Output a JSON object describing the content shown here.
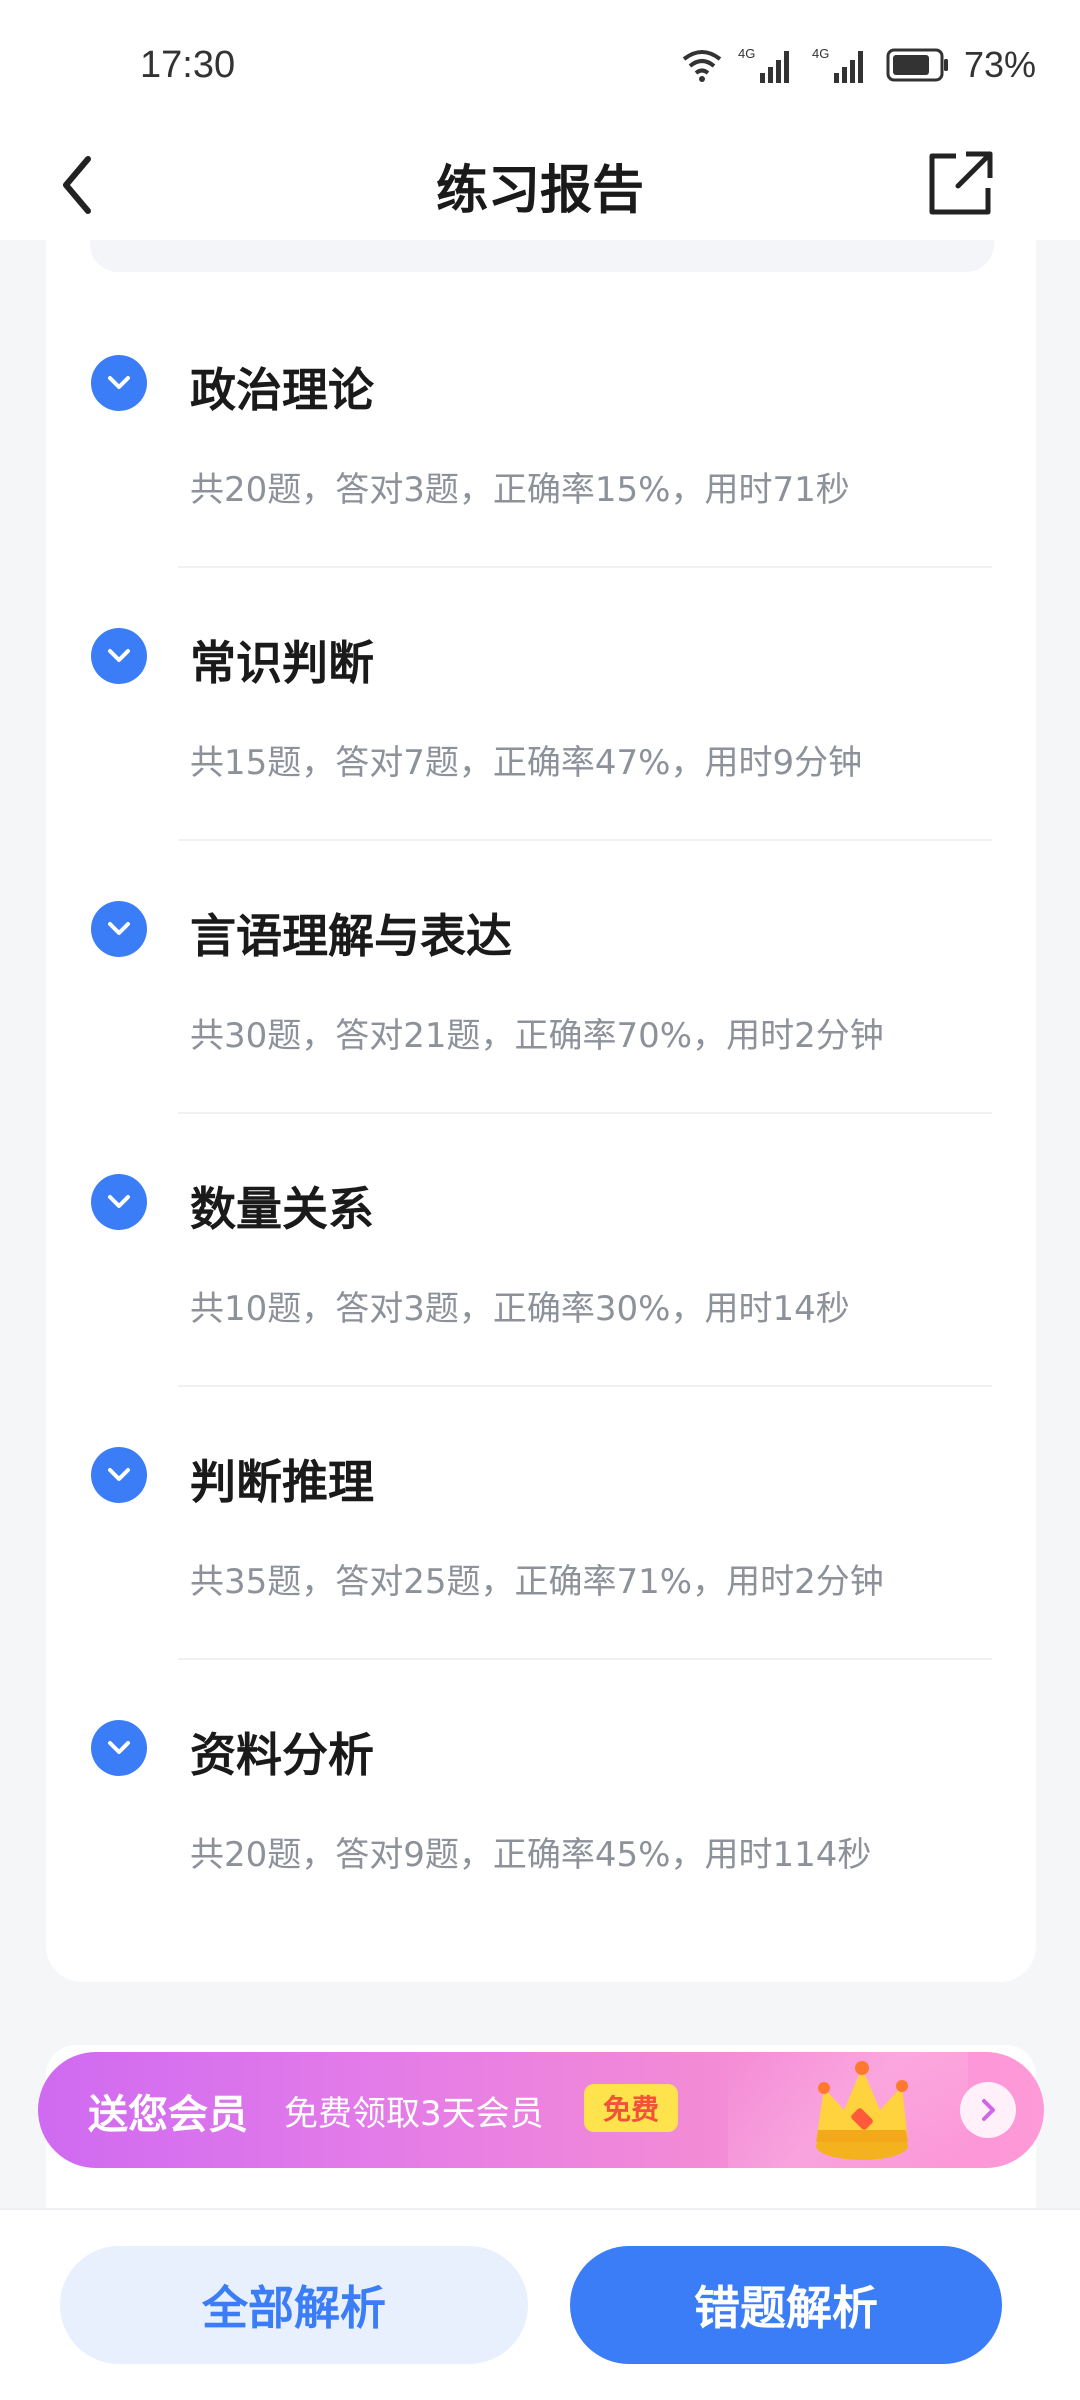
{
  "status_bar": {
    "time": "17:30",
    "network_1": "4G",
    "network_2": "4G",
    "battery": "73%"
  },
  "nav": {
    "title": "练习报告",
    "back_icon": "chevron-left-icon",
    "share_icon": "share-external-icon"
  },
  "sections": [
    {
      "title": "政治理论",
      "stats": "共20题，答对3题，正确率15%，用时71秒"
    },
    {
      "title": "常识判断",
      "stats": "共15题，答对7题，正确率47%，用时9分钟"
    },
    {
      "title": "言语理解与表达",
      "stats": "共30题，答对21题，正确率70%，用时2分钟"
    },
    {
      "title": "数量关系",
      "stats": "共10题，答对3题，正确率30%，用时14秒"
    },
    {
      "title": "判断推理",
      "stats": "共35题，答对25题，正确率71%，用时2分钟"
    },
    {
      "title": "资料分析",
      "stats": "共20题，答对9题，正确率45%，用时114秒"
    }
  ],
  "promo": {
    "main": "送您会员",
    "sub": "免费领取3天会员",
    "badge": "免费"
  },
  "buttons": {
    "all": "全部解析",
    "wrong": "错题解析"
  },
  "colors": {
    "accent": "#3b7df7",
    "accent_light": "#e8f0fe",
    "promo_start": "#cf6af1",
    "promo_end": "#ff9ad8"
  }
}
